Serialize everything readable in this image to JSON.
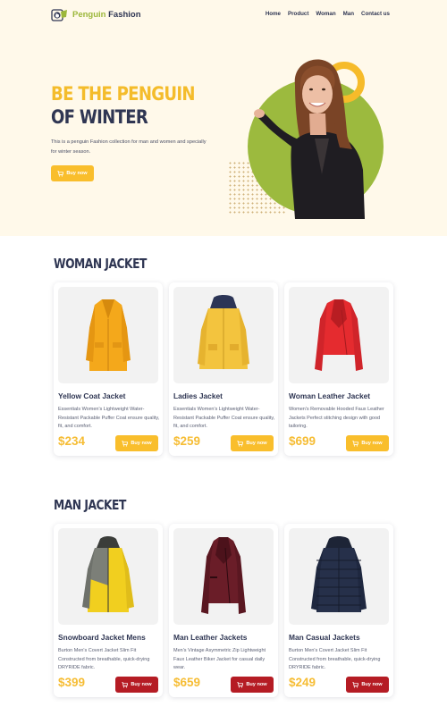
{
  "brand": {
    "name_part1": "Penguin",
    "name_part2": "Fashion"
  },
  "nav": {
    "items": [
      "Home",
      "Product",
      "Woman",
      "Man",
      "Contact us"
    ]
  },
  "hero": {
    "title_line1": "BE THE PENGUIN",
    "title_line2": "OF WINTER",
    "description": "This is a penguin Fashion collection for man and women and specially for winter season.",
    "button_label": "Buy now"
  },
  "sections": [
    {
      "title": "WOMAN JACKET",
      "products": [
        {
          "name": "Yellow Coat Jacket",
          "description": "Essentials Women's Lightweight Water-Resistant Packable Puffer Coat ensure quality, fit, and comfort.",
          "price": "$234",
          "button": "Buy now",
          "image_icon": "yellow-coat-icon"
        },
        {
          "name": "Ladies Jacket",
          "description": "Essentials Women's Lightweight Water-Resistant Packable Puffer Coat ensure quality, fit, and comfort.",
          "price": "$259",
          "button": "Buy now",
          "image_icon": "yellow-hooded-jacket-icon"
        },
        {
          "name": "Woman Leather Jacket",
          "description": "Women's Removable Hooded Faux Leather Jackets Perfect stitching design with good tailoring.",
          "price": "$699",
          "button": "Buy now",
          "image_icon": "red-leather-jacket-icon"
        }
      ]
    },
    {
      "title": "MAN JACKET",
      "products": [
        {
          "name": "Snowboard Jacket Mens",
          "description": "Burton Men's Covert Jacket Slim Fit Constructed from breathable, quick-drying DRYRIDE fabric.",
          "price": "$399",
          "button": "Buy now",
          "image_icon": "snowboard-jacket-icon"
        },
        {
          "name": "Man Leather Jackets",
          "description": "Men's Vintage Asymmetric Zip Lightweight Faux Leather Biker Jacket for casual daily wear.",
          "price": "$659",
          "button": "Buy now",
          "image_icon": "maroon-leather-jacket-icon"
        },
        {
          "name": "Man Casual Jackets",
          "description": "Burton Men's Covert Jacket Slim Fit Constructed from breathable, quick-drying DRYRIDE fabric.",
          "price": "$249",
          "button": "Buy now",
          "image_icon": "navy-puffer-jacket-icon"
        }
      ]
    }
  ],
  "colors": {
    "accent_yellow": "#f9be2c",
    "accent_green": "#9cba3e",
    "dark_navy": "#2f3653",
    "buy_red": "#b51c24",
    "hero_bg": "#fff9ea"
  }
}
